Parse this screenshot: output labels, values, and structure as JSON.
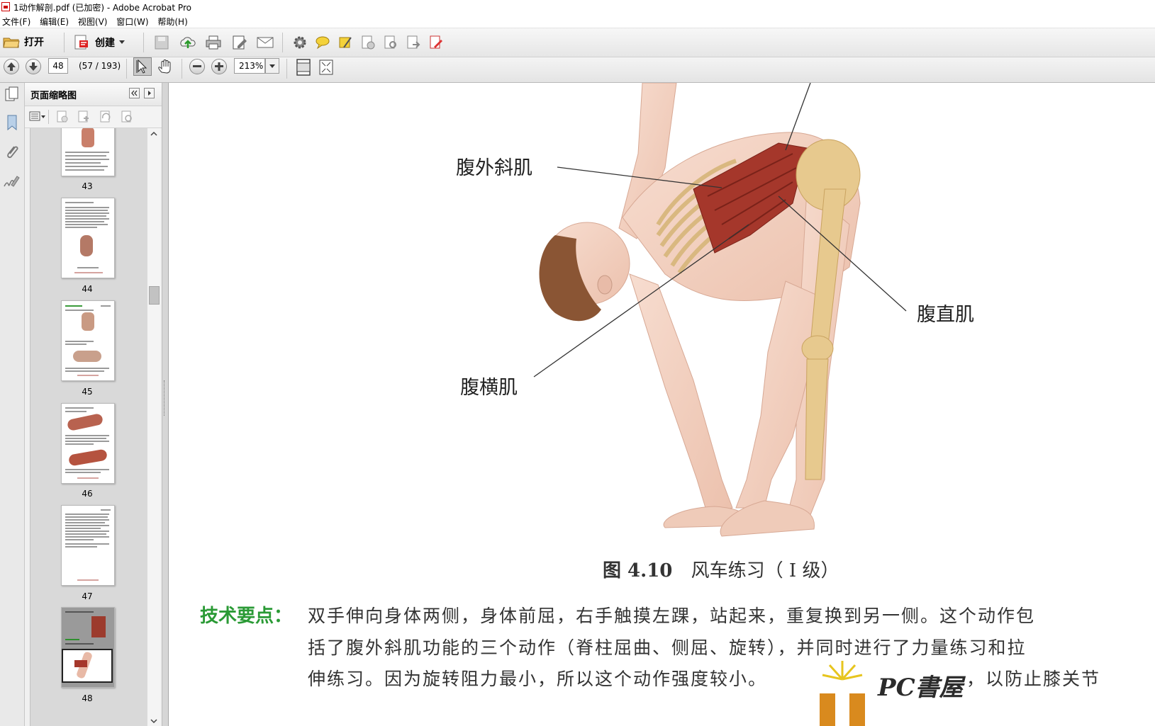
{
  "window": {
    "title": "1动作解剖.pdf  (已加密)   - Adobe Acrobat Pro"
  },
  "menu": [
    "文件(F)",
    "编辑(E)",
    "视图(V)",
    "窗口(W)",
    "帮助(H)"
  ],
  "toolbar": {
    "open_label": "打开",
    "create_label": "创建"
  },
  "nav": {
    "page_number": "48",
    "page_range": "(57 / 193)",
    "zoom": "213%"
  },
  "panel": {
    "title": "页面缩略图",
    "thumbnails": [
      {
        "label": "43"
      },
      {
        "label": "44"
      },
      {
        "label": "45"
      },
      {
        "label": "46"
      },
      {
        "label": "47"
      },
      {
        "label": "48"
      }
    ]
  },
  "figure": {
    "labels": {
      "oblique": "腹外斜肌",
      "rectus": "腹直肌",
      "transverse": "腹横肌"
    },
    "caption_number": "图 4.10",
    "caption_text": "风车练习（ Ⅰ 级）"
  },
  "body": {
    "heading": "技术要点：",
    "line1": "双手伸向身体两侧，身体前屈，右手触摸左踝，站起来，重复换到另一侧。这个动作包",
    "line2": "括了腹外斜肌功能的三个动作（脊柱屈曲、侧屈、旋转），并同时进行了力量练习和拉",
    "line3": "伸练习。因为旋转阻力最小，所以这个动作强度较小。",
    "line3_tail": "，以防止膝关节",
    "watermark": "PC書屋"
  },
  "colors": {
    "heading_green": "#2a9a35",
    "muscle_red": "#a5372b",
    "skin": "#f2cfc0",
    "bone": "#e7c98e"
  }
}
